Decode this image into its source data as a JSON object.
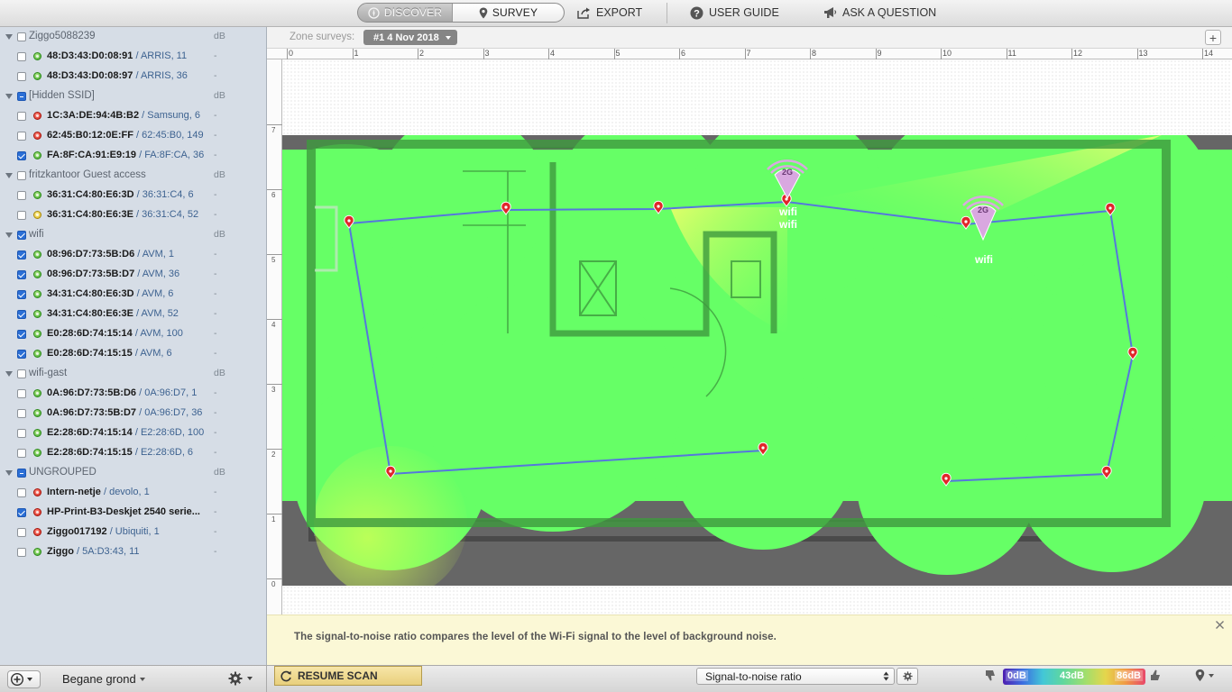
{
  "toolbar": {
    "discover": "DISCOVER",
    "survey": "SURVEY",
    "export": "EXPORT",
    "user_guide": "USER GUIDE",
    "ask": "ASK A QUESTION"
  },
  "sidebar": {
    "groups": [
      {
        "name": "Ziggo5088239",
        "db": "dB",
        "check": "off",
        "rows": [
          {
            "mac": "48:D3:43:D0:08:91",
            "detail": " / ARRIS, 11",
            "dot": "green",
            "check": "off",
            "val": "-"
          },
          {
            "mac": "48:D3:43:D0:08:97",
            "detail": " / ARRIS, 36",
            "dot": "green",
            "check": "off",
            "val": "-"
          }
        ]
      },
      {
        "name": "[Hidden SSID]",
        "db": "dB",
        "check": "mix",
        "rows": [
          {
            "mac": "1C:3A:DE:94:4B:B2",
            "detail": " / Samsung, 6",
            "dot": "red",
            "check": "off",
            "val": "-"
          },
          {
            "mac": "62:45:B0:12:0E:FF",
            "detail": " / 62:45:B0, 149",
            "dot": "red",
            "check": "off",
            "val": "-"
          },
          {
            "mac": "FA:8F:CA:91:E9:19",
            "detail": " / FA:8F:CA, 36",
            "dot": "green",
            "check": "on",
            "val": "-"
          }
        ]
      },
      {
        "name": "fritzkantoor Guest access",
        "db": "dB",
        "check": "off",
        "rows": [
          {
            "mac": "36:31:C4:80:E6:3D",
            "detail": " / 36:31:C4, 6",
            "dot": "green",
            "check": "off",
            "val": "-"
          },
          {
            "mac": "36:31:C4:80:E6:3E",
            "detail": " / 36:31:C4, 52",
            "dot": "yellow",
            "check": "off",
            "val": "-"
          }
        ]
      },
      {
        "name": "wifi",
        "db": "dB",
        "check": "on",
        "rows": [
          {
            "mac": "08:96:D7:73:5B:D6",
            "detail": " / AVM, 1",
            "dot": "green",
            "check": "on",
            "val": "-"
          },
          {
            "mac": "08:96:D7:73:5B:D7",
            "detail": " / AVM, 36",
            "dot": "green",
            "check": "on",
            "val": "-"
          },
          {
            "mac": "34:31:C4:80:E6:3D",
            "detail": " / AVM, 6",
            "dot": "green",
            "check": "on",
            "val": "-"
          },
          {
            "mac": "34:31:C4:80:E6:3E",
            "detail": " / AVM, 52",
            "dot": "green",
            "check": "on",
            "val": "-"
          },
          {
            "mac": "E0:28:6D:74:15:14",
            "detail": " / AVM, 100",
            "dot": "green",
            "check": "on",
            "val": "-"
          },
          {
            "mac": "E0:28:6D:74:15:15",
            "detail": " / AVM, 6",
            "dot": "green",
            "check": "on",
            "val": "-"
          }
        ]
      },
      {
        "name": "wifi-gast",
        "db": "dB",
        "check": "off",
        "rows": [
          {
            "mac": "0A:96:D7:73:5B:D6",
            "detail": " / 0A:96:D7, 1",
            "dot": "green",
            "check": "off",
            "val": "-"
          },
          {
            "mac": "0A:96:D7:73:5B:D7",
            "detail": " / 0A:96:D7, 36",
            "dot": "green",
            "check": "off",
            "val": "-"
          },
          {
            "mac": "E2:28:6D:74:15:14",
            "detail": " / E2:28:6D, 100",
            "dot": "green",
            "check": "off",
            "val": "-"
          },
          {
            "mac": "E2:28:6D:74:15:15",
            "detail": " / E2:28:6D, 6",
            "dot": "green",
            "check": "off",
            "val": "-"
          }
        ]
      },
      {
        "name": "UNGROUPED",
        "db": "dB",
        "check": "mix",
        "rows": [
          {
            "mac": "Intern-netje",
            "detail": " / devolo, 1",
            "dot": "red",
            "check": "off",
            "val": "-"
          },
          {
            "mac": "HP-Print-B3-Deskjet 2540 serie...",
            "detail": "",
            "dot": "red",
            "check": "on",
            "val": "-"
          },
          {
            "mac": "Ziggo017192",
            "detail": " / Ubiquiti, 1",
            "dot": "red",
            "check": "off",
            "val": "-"
          },
          {
            "mac": "Ziggo",
            "detail": " / 5A:D3:43, 11",
            "dot": "green",
            "check": "off",
            "val": "-"
          }
        ]
      }
    ],
    "floor": "Begane grond"
  },
  "zone": {
    "label": "Zone surveys:",
    "selected": "#1 4 Nov 2018",
    "add": "+"
  },
  "ruler": {
    "h_ticks": [
      "0",
      "1",
      "2",
      "3",
      "4",
      "5",
      "6",
      "7",
      "8",
      "9",
      "10",
      "11",
      "12",
      "13",
      "14"
    ],
    "v_ticks": [
      "7",
      "6",
      "5",
      "4",
      "3",
      "2",
      "1",
      "0"
    ]
  },
  "plan": {
    "ap_badge": "2G",
    "ap_labels": [
      "wifi",
      "wifi",
      "wifi"
    ]
  },
  "info": {
    "text": "The signal-to-noise ratio compares the level of the Wi-Fi signal to the level of background noise."
  },
  "bottom": {
    "resume": "RESUME SCAN",
    "visualization": "Signal-to-noise ratio",
    "legend": [
      "0dB",
      "43dB",
      "86dB"
    ]
  },
  "colors": {
    "coverage": "#66ff66",
    "path": "#5577dd",
    "marker": "#e0262a",
    "ap": "#d9a8e0"
  },
  "icons": [
    "compass-icon",
    "pin-icon",
    "export-icon",
    "help-icon",
    "megaphone-icon",
    "gear-icon",
    "refresh-icon",
    "thumbs-down-icon",
    "thumbs-up-icon",
    "location-icon"
  ]
}
